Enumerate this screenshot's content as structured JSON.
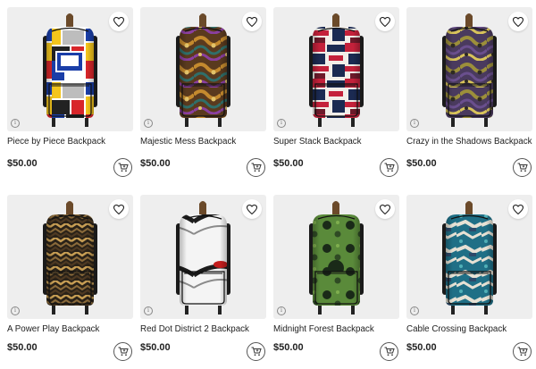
{
  "products": [
    {
      "name": "Piece by Piece Backpack",
      "price": "$50.00",
      "pattern": "mondrian",
      "colors": [
        "#1a3ea8",
        "#d8262a",
        "#f4c51c",
        "#ffffff",
        "#222222"
      ]
    },
    {
      "name": "Majestic Mess Backpack",
      "price": "$50.00",
      "pattern": "swirl",
      "colors": [
        "#5a3a1e",
        "#c48a2e",
        "#2f6f6a",
        "#8a3fa0",
        "#e2c36a"
      ]
    },
    {
      "name": "Super Stack Backpack",
      "price": "$50.00",
      "pattern": "stack",
      "colors": [
        "#1b2a52",
        "#c4213b",
        "#f2eee9",
        "#6d1a2a"
      ]
    },
    {
      "name": "Crazy in the Shadows Backpack",
      "price": "$50.00",
      "pattern": "swirl",
      "colors": [
        "#4a3a5e",
        "#9c8f3a",
        "#6a4f8e",
        "#d8c35a",
        "#2e2a22"
      ]
    },
    {
      "name": "A Power Play Backpack",
      "price": "$50.00",
      "pattern": "zigzag",
      "colors": [
        "#2a2218",
        "#8a6a3a",
        "#c79e54",
        "#4f3a22",
        "#1b1610"
      ]
    },
    {
      "name": "Red Dot District 2 Backpack",
      "price": "$50.00",
      "pattern": "reddot",
      "colors": [
        "#f4f4f4",
        "#1c1c1c",
        "#c41e1e",
        "#8a8a8a"
      ]
    },
    {
      "name": "Midnight Forest Backpack",
      "price": "$50.00",
      "pattern": "dots",
      "colors": [
        "#5a8a3a",
        "#1a2a18",
        "#7fae4e",
        "#2f4a24"
      ]
    },
    {
      "name": "Cable Crossing Backpack",
      "price": "$50.00",
      "pattern": "cable",
      "colors": [
        "#1f6f86",
        "#e6e1d4",
        "#2d4a6a",
        "#4fb0b8",
        "#7a6a5a"
      ]
    }
  ]
}
